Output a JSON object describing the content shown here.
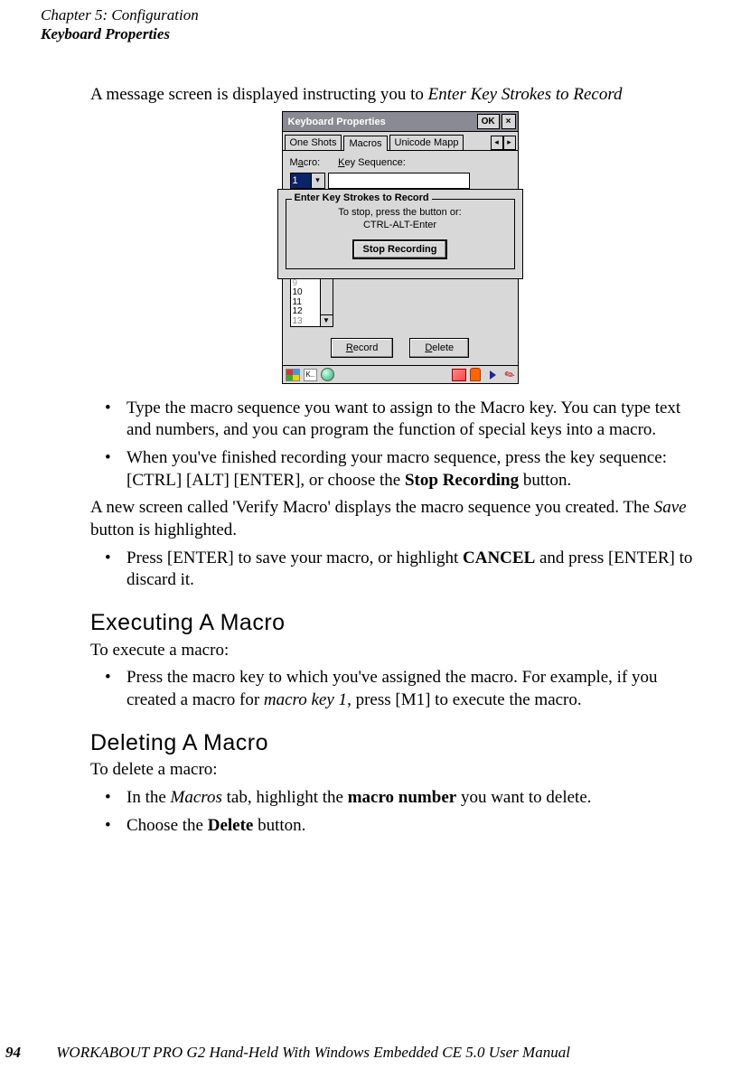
{
  "header": {
    "chapter": "Chapter 5: Configuration",
    "section": "Keyboard Properties"
  },
  "intro": {
    "pre": "A message screen is displayed instructing you to ",
    "ital": "Enter Key Strokes to Record"
  },
  "screenshot": {
    "title": "Keyboard Properties",
    "ok": "OK",
    "close": "×",
    "tabs": {
      "t1": "One Shots",
      "t2": "Macros",
      "t3": "Unicode Mapp"
    },
    "labels": {
      "macro_pre": "M",
      "macro_u": "a",
      "macro_post": "cro:",
      "keyseq_pre": "",
      "keyseq_u": "K",
      "keyseq_post": "ey Sequence:"
    },
    "macro_value": "1",
    "overlay": {
      "legend": "Enter Key Strokes to Record",
      "msg1": "To stop, press the button or:",
      "msg2": "CTRL-ALT-Enter",
      "button": "Stop Recording"
    },
    "list": {
      "r1": "10",
      "r2": "11",
      "r3": "12",
      "r4": "13"
    },
    "buttons": {
      "record_u": "R",
      "record_post": "ecord",
      "delete_u": "D",
      "delete_post": "elete"
    },
    "taskbar": {
      "kbd": "K.."
    }
  },
  "bullets1": {
    "b1": "Type the macro sequence you want to assign to the Macro key. You can type text and numbers, and you can program the function of special keys into a macro.",
    "b2_pre": "When you've finished recording your macro sequence, press the key sequence: [CTRL] [ALT] [ENTER], or choose the ",
    "b2_bold": "Stop Recording",
    "b2_post": " button."
  },
  "para2": {
    "pre": "A new screen called 'Verify Macro' displays the macro sequence you created. The ",
    "ital": "Save",
    "post": " button is highlighted."
  },
  "bullets2": {
    "b1_pre": "Press [ENTER] to save your macro, or highlight ",
    "b1_bold": "CANCEL",
    "b1_post": " and press [ENTER] to discard it."
  },
  "exec": {
    "heading": "Executing A Macro",
    "intro": "To execute a macro:",
    "b_pre": "Press the macro key to which you've assigned the macro. For example, if you created a macro for ",
    "b_ital": "macro key 1",
    "b_post": ", press [M1] to execute the macro."
  },
  "del": {
    "heading": "Deleting A Macro",
    "intro": "To delete a macro:",
    "b1_pre": "In the ",
    "b1_ital": "Macros",
    "b1_mid": " tab, highlight the ",
    "b1_bold": "macro number",
    "b1_post": " you want to delete.",
    "b2_pre": "Choose the ",
    "b2_bold": "Delete",
    "b2_post": " button."
  },
  "footer": {
    "page": "94",
    "title": "WORKABOUT PRO G2 Hand-Held With Windows Embedded CE 5.0 User Manual"
  }
}
